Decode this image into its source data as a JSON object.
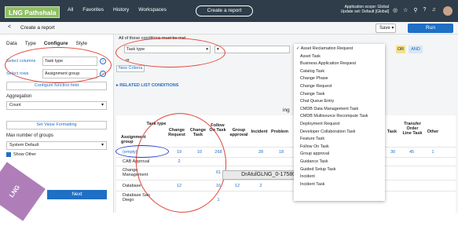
{
  "header": {
    "logo": "LNG Pathshala",
    "nav": [
      "All",
      "Favorites",
      "History",
      "Workspaces"
    ],
    "create_report": "Create a report",
    "scope_line1": "Application scope: Global",
    "scope_line2": "Update set: Default [Global]"
  },
  "subbar": {
    "back": "<",
    "title": "Create a report",
    "save": "Save",
    "run": "Run"
  },
  "left": {
    "tabs": [
      "Data",
      "Type",
      "Configure",
      "Style"
    ],
    "select_columns_label": "Select columns",
    "select_columns_value": "Task type",
    "select_rows_label": "Select rows",
    "select_rows_value": "Assignment group",
    "configure_function": "Configure function field",
    "aggregation_label": "Aggregation",
    "aggregation_value": "Count",
    "set_value_formatting": "Set Value Formatting",
    "max_groups_label": "Max number of groups",
    "max_groups_value": "System Default",
    "show_other": "Show Other",
    "next": "Next",
    "watermark": "LNG Pathshala"
  },
  "conditions": {
    "heading": "All of these conditions must be met",
    "field": "Task type",
    "or_text": "or",
    "new_criteria": "New Criteria",
    "or_btn": "OR",
    "and_btn": "AND",
    "related": "RELATED LIST CONDITIONS"
  },
  "table": {
    "group_heading": "ing",
    "col_head_assignment": "Assignment group",
    "headers": [
      "Task type",
      "Change Request",
      "Change Task",
      "Follow On Task",
      "Group approval",
      "Incident",
      "Problem",
      "Task",
      "Transfer Order Line Task",
      "Other"
    ],
    "rows": [
      {
        "name": "(empty)",
        "values": [
          "19",
          "10",
          "268",
          "28",
          "18",
          "30",
          "45",
          "1"
        ]
      },
      {
        "name": "CAB Approval",
        "values": [
          "2",
          "",
          "",
          "",
          "",
          "",
          "",
          ""
        ]
      },
      {
        "name": "Change Management",
        "values": [
          "",
          "",
          "61",
          "",
          "",
          "",
          "",
          ""
        ]
      },
      {
        "name": "Database",
        "values": [
          "12",
          "16",
          "12",
          "2",
          "",
          "",
          "",
          ""
        ]
      },
      {
        "name": "Database San Diego",
        "values": [
          "",
          "1",
          "",
          "",
          "",
          "",
          "",
          ""
        ]
      }
    ]
  },
  "dropdown": {
    "items": [
      "Asset Reclamation Request",
      "Asset Task",
      "Business Application Request",
      "Catalog Task",
      "Change Phase",
      "Change Request",
      "Change Task",
      "Chat Queue Entry",
      "CMDB Data Management Task",
      "CMDB Multisource Recompute Task",
      "Deployment Request",
      "Developer Collaboration Task",
      "Feature Task",
      "Follow On Task",
      "Group approval",
      "Guidance Task",
      "Guided Setup Task",
      "Incident",
      "Incident Task"
    ]
  },
  "tooltip": "DrAtulGLNG_0-1758009670206.png"
}
